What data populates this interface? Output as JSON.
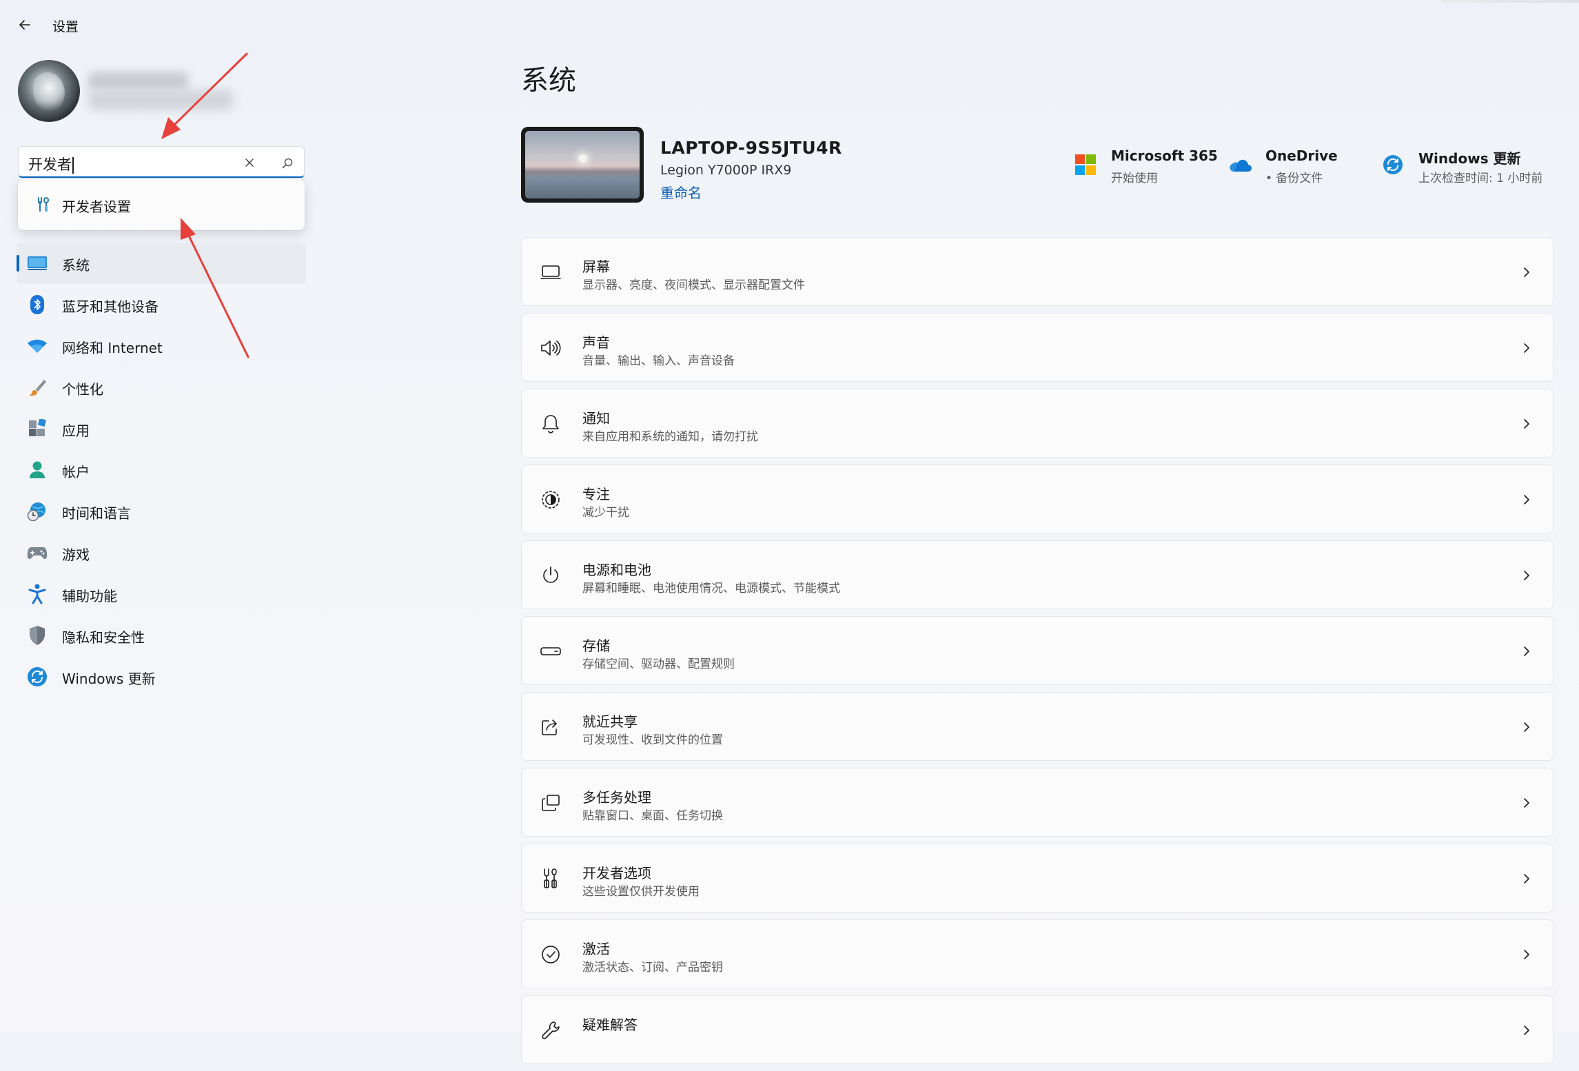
{
  "titlebar": {
    "title": "设置"
  },
  "search": {
    "value": "开发者",
    "suggestion": "开发者设置"
  },
  "nav": {
    "items": [
      {
        "label": "系统",
        "icon": "system-icon",
        "active": true
      },
      {
        "label": "蓝牙和其他设备",
        "icon": "bluetooth-icon"
      },
      {
        "label": "网络和 Internet",
        "icon": "wifi-icon"
      },
      {
        "label": "个性化",
        "icon": "brush-icon"
      },
      {
        "label": "应用",
        "icon": "apps-icon"
      },
      {
        "label": "帐户",
        "icon": "account-icon"
      },
      {
        "label": "时间和语言",
        "icon": "time-language-icon"
      },
      {
        "label": "游戏",
        "icon": "gamepad-icon"
      },
      {
        "label": "辅助功能",
        "icon": "accessibility-icon"
      },
      {
        "label": "隐私和安全性",
        "icon": "shield-icon"
      },
      {
        "label": "Windows 更新",
        "icon": "windows-update-icon"
      }
    ]
  },
  "main": {
    "title": "系统",
    "device": {
      "name": "LAPTOP-9S5JTU4R",
      "model": "Legion Y7000P IRX9",
      "rename": "重命名"
    },
    "quick": [
      {
        "title": "Microsoft 365",
        "sub": "开始使用",
        "icon": "microsoft-365-icon"
      },
      {
        "title": "OneDrive",
        "sub": "• 备份文件",
        "icon": "onedrive-icon"
      },
      {
        "title": "Windows 更新",
        "sub": "上次检查时间: 1 小时前",
        "icon": "windows-update-icon"
      }
    ],
    "cards": [
      {
        "title": "屏幕",
        "sub": "显示器、亮度、夜间模式、显示器配置文件",
        "icon": "display-icon"
      },
      {
        "title": "声音",
        "sub": "音量、输出、输入、声音设备",
        "icon": "speaker-icon"
      },
      {
        "title": "通知",
        "sub": "来自应用和系统的通知，请勿打扰",
        "icon": "bell-icon"
      },
      {
        "title": "专注",
        "sub": "减少干扰",
        "icon": "focus-icon"
      },
      {
        "title": "电源和电池",
        "sub": "屏幕和睡眠、电池使用情况、电源模式、节能模式",
        "icon": "power-icon"
      },
      {
        "title": "存储",
        "sub": "存储空间、驱动器、配置规则",
        "icon": "storage-icon"
      },
      {
        "title": "就近共享",
        "sub": "可发现性、收到文件的位置",
        "icon": "share-icon"
      },
      {
        "title": "多任务处理",
        "sub": "贴靠窗口、桌面、任务切换",
        "icon": "multitask-icon"
      },
      {
        "title": "开发者选项",
        "sub": "这些设置仅供开发使用",
        "icon": "developer-tools-icon"
      },
      {
        "title": "激活",
        "sub": "激活状态、订阅、产品密钥",
        "icon": "check-circle-icon"
      },
      {
        "title": "疑难解答",
        "sub": "",
        "icon": "wrench-icon"
      }
    ]
  },
  "colors": {
    "accent": "#0067c0",
    "annotation_arrow": "#e8403a"
  }
}
